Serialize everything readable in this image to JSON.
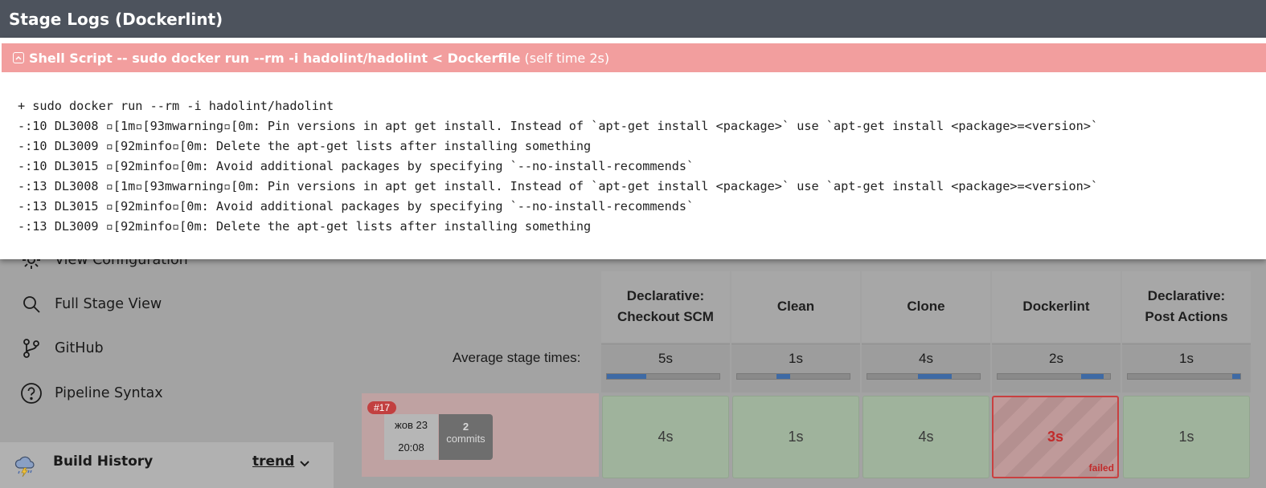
{
  "modal": {
    "title": "Stage Logs (Dockerlint)",
    "step": {
      "title": "Shell Script -- sudo docker run --rm -i hadolint/hadolint < Dockerfile",
      "self_time": "(self time 2s)",
      "icon": "collapse-icon"
    },
    "log_lines": [
      "+ sudo docker run --rm -i hadolint/hadolint",
      "-:10 DL3008 ▫[1m▫[93mwarning▫[0m: Pin versions in apt get install. Instead of `apt-get install <package>` use `apt-get install <package>=<version>`",
      "-:10 DL3009 ▫[92minfo▫[0m: Delete the apt-get lists after installing something",
      "-:10 DL3015 ▫[92minfo▫[0m: Avoid additional packages by specifying `--no-install-recommends`",
      "-:13 DL3008 ▫[1m▫[93mwarning▫[0m: Pin versions in apt get install. Instead of `apt-get install <package>` use `apt-get install <package>=<version>`",
      "-:13 DL3015 ▫[92minfo▫[0m: Avoid additional packages by specifying `--no-install-recommends`",
      "-:13 DL3009 ▫[92minfo▫[0m: Delete the apt-get lists after installing something"
    ]
  },
  "sidebar": {
    "items": [
      {
        "label": "View Configuration",
        "icon": "gear-icon"
      },
      {
        "label": "Full Stage View",
        "icon": "search-icon"
      },
      {
        "label": "GitHub",
        "icon": "git-branch-icon"
      },
      {
        "label": "Pipeline Syntax",
        "icon": "help-icon"
      }
    ]
  },
  "build_history": {
    "title": "Build History",
    "trend_label": "trend",
    "icon": "weather-storm-icon"
  },
  "stage_view": {
    "average_label": "Average stage times:",
    "stages": [
      {
        "name_line1": "Declarative:",
        "name_line2": "Checkout SCM",
        "avg": "5s",
        "avg_fraction": 0.35
      },
      {
        "name_line1": "Clean",
        "name_line2": "",
        "avg": "1s",
        "avg_fraction": 0.12
      },
      {
        "name_line1": "Clone",
        "name_line2": "",
        "avg": "4s",
        "avg_fraction": 0.3
      },
      {
        "name_line1": "Dockerlint",
        "name_line2": "",
        "avg": "2s",
        "avg_fraction": 0.2
      },
      {
        "name_line1": "Declarative:",
        "name_line2": "Post Actions",
        "avg": "1s",
        "avg_fraction": 0.07
      }
    ],
    "run": {
      "badge": "#17",
      "date": "жов 23",
      "time": "20:08",
      "commits_count": "2",
      "commits_label": "commits",
      "cells": [
        "4s",
        "1s",
        "4s",
        "3s",
        "1s"
      ],
      "failed_index": 3,
      "failed_label": "failed"
    }
  },
  "colors": {
    "modal_header": "#4d535d",
    "step_bar": "#f29e9e",
    "failed": "#c94040",
    "success_cell": "#9fb39c",
    "avg_bar": "#3e6aa5"
  }
}
